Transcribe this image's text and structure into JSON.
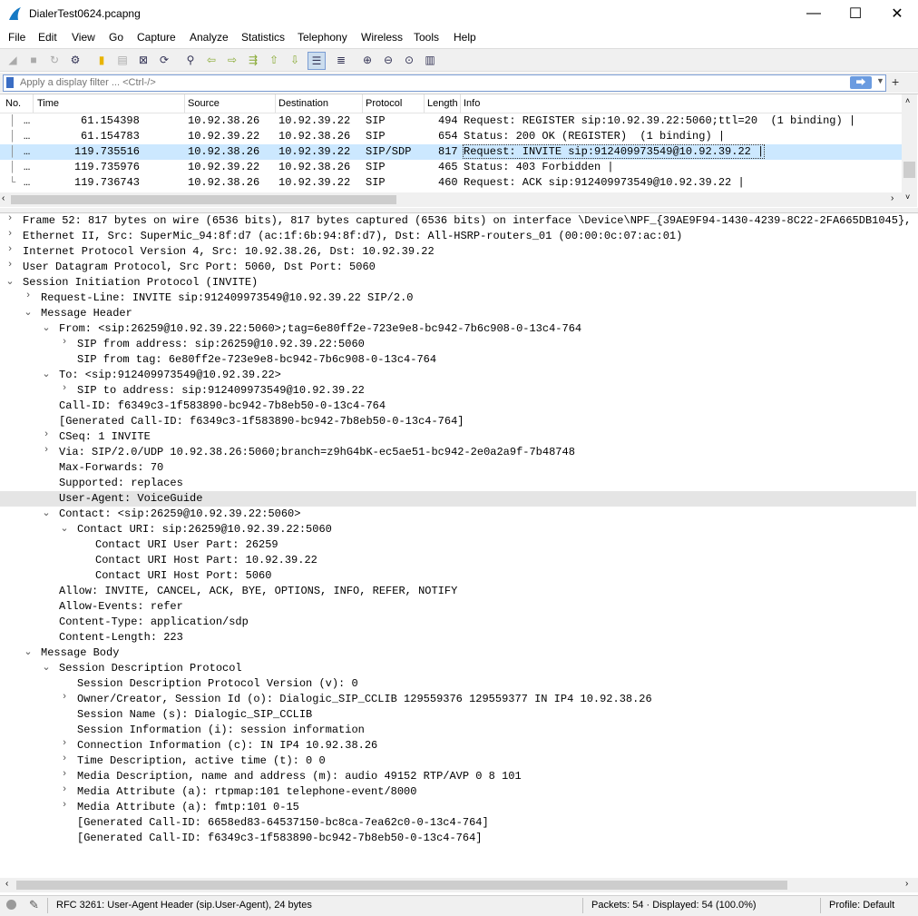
{
  "window": {
    "title": "DialerTest0624.pcapng",
    "minimize": "—",
    "maximize": "☐",
    "close": "✕"
  },
  "menu": [
    "File",
    "Edit",
    "View",
    "Go",
    "Capture",
    "Analyze",
    "Statistics",
    "Telephony",
    "Wireless",
    "Tools",
    "Help"
  ],
  "filter": {
    "placeholder": "Apply a display filter ... <Ctrl-/>",
    "apply": "⮕",
    "dropdown": "▼",
    "add": "+"
  },
  "packet_list": {
    "columns": [
      "No.",
      "Time",
      "Source",
      "Destination",
      "Protocol",
      "Length",
      "Info"
    ],
    "rows": [
      {
        "no": "…",
        "time": "61.154398",
        "src": "10.92.38.26",
        "dst": "10.92.39.22",
        "proto": "SIP",
        "len": "494",
        "info": "Request: REGISTER sip:10.92.39.22:5060;ttl=20  (1 binding) |"
      },
      {
        "no": "…",
        "time": "61.154783",
        "src": "10.92.39.22",
        "dst": "10.92.38.26",
        "proto": "SIP",
        "len": "654",
        "info": "Status: 200 OK (REGISTER)  (1 binding) |"
      },
      {
        "no": "…",
        "time": "119.735516",
        "src": "10.92.38.26",
        "dst": "10.92.39.22",
        "proto": "SIP/SDP",
        "len": "817",
        "info": "Request: INVITE sip:912409973549@10.92.39.22 |"
      },
      {
        "no": "…",
        "time": "119.735976",
        "src": "10.92.39.22",
        "dst": "10.92.38.26",
        "proto": "SIP",
        "len": "465",
        "info": "Status: 403 Forbidden |"
      },
      {
        "no": "…",
        "time": "119.736743",
        "src": "10.92.38.26",
        "dst": "10.92.39.22",
        "proto": "SIP",
        "len": "460",
        "info": "Request: ACK sip:912409973549@10.92.39.22 |"
      }
    ]
  },
  "details": [
    {
      "t": "Frame 52: 817 bytes on wire (6536 bits), 817 bytes captured (6536 bits) on interface \\Device\\NPF_{39AE9F94-1430-4239-8C22-2FA665DB1045}, id 0",
      "a": ">",
      "l": 0
    },
    {
      "t": "Ethernet II, Src: SuperMic_94:8f:d7 (ac:1f:6b:94:8f:d7), Dst: All-HSRP-routers_01 (00:00:0c:07:ac:01)",
      "a": ">",
      "l": 0
    },
    {
      "t": "Internet Protocol Version 4, Src: 10.92.38.26, Dst: 10.92.39.22",
      "a": ">",
      "l": 0
    },
    {
      "t": "User Datagram Protocol, Src Port: 5060, Dst Port: 5060",
      "a": ">",
      "l": 0
    },
    {
      "t": "Session Initiation Protocol (INVITE)",
      "a": "v",
      "l": 0
    },
    {
      "t": "Request-Line: INVITE sip:912409973549@10.92.39.22 SIP/2.0",
      "a": ">",
      "l": 1
    },
    {
      "t": "Message Header",
      "a": "v",
      "l": 1
    },
    {
      "t": "From: <sip:26259@10.92.39.22:5060>;tag=6e80ff2e-723e9e8-bc942-7b6c908-0-13c4-764",
      "a": "v",
      "l": 2
    },
    {
      "t": "SIP from address: sip:26259@10.92.39.22:5060",
      "a": ">",
      "l": 3
    },
    {
      "t": "SIP from tag: 6e80ff2e-723e9e8-bc942-7b6c908-0-13c4-764",
      "a": "",
      "l": 3
    },
    {
      "t": "To: <sip:912409973549@10.92.39.22>",
      "a": "v",
      "l": 2
    },
    {
      "t": "SIP to address: sip:912409973549@10.92.39.22",
      "a": ">",
      "l": 3
    },
    {
      "t": "Call-ID: f6349c3-1f583890-bc942-7b8eb50-0-13c4-764",
      "a": "",
      "l": 2
    },
    {
      "t": "[Generated Call-ID: f6349c3-1f583890-bc942-7b8eb50-0-13c4-764]",
      "a": "",
      "l": 2
    },
    {
      "t": "CSeq: 1 INVITE",
      "a": ">",
      "l": 2
    },
    {
      "t": "Via: SIP/2.0/UDP 10.92.38.26:5060;branch=z9hG4bK-ec5ae51-bc942-2e0a2a9f-7b48748",
      "a": ">",
      "l": 2
    },
    {
      "t": "Max-Forwards: 70",
      "a": "",
      "l": 2
    },
    {
      "t": "Supported: replaces",
      "a": "",
      "l": 2
    },
    {
      "t": "User-Agent: VoiceGuide",
      "a": "",
      "l": 2,
      "hl": true
    },
    {
      "t": "Contact: <sip:26259@10.92.39.22:5060>",
      "a": "v",
      "l": 2
    },
    {
      "t": "Contact URI: sip:26259@10.92.39.22:5060",
      "a": "v",
      "l": 3
    },
    {
      "t": "Contact URI User Part: 26259",
      "a": "",
      "l": 4
    },
    {
      "t": "Contact URI Host Part: 10.92.39.22",
      "a": "",
      "l": 4
    },
    {
      "t": "Contact URI Host Port: 5060",
      "a": "",
      "l": 4
    },
    {
      "t": "Allow: INVITE, CANCEL, ACK, BYE, OPTIONS, INFO, REFER, NOTIFY",
      "a": "",
      "l": 2
    },
    {
      "t": "Allow-Events: refer",
      "a": "",
      "l": 2
    },
    {
      "t": "Content-Type: application/sdp",
      "a": "",
      "l": 2
    },
    {
      "t": "Content-Length: 223",
      "a": "",
      "l": 2
    },
    {
      "t": "Message Body",
      "a": "v",
      "l": 1
    },
    {
      "t": "Session Description Protocol",
      "a": "v",
      "l": 2
    },
    {
      "t": "Session Description Protocol Version (v): 0",
      "a": "",
      "l": 3
    },
    {
      "t": "Owner/Creator, Session Id (o): Dialogic_SIP_CCLIB 129559376 129559377 IN IP4 10.92.38.26",
      "a": ">",
      "l": 3
    },
    {
      "t": "Session Name (s): Dialogic_SIP_CCLIB",
      "a": "",
      "l": 3
    },
    {
      "t": "Session Information (i): session information",
      "a": "",
      "l": 3
    },
    {
      "t": "Connection Information (c): IN IP4 10.92.38.26",
      "a": ">",
      "l": 3
    },
    {
      "t": "Time Description, active time (t): 0 0",
      "a": ">",
      "l": 3
    },
    {
      "t": "Media Description, name and address (m): audio 49152 RTP/AVP 0 8 101",
      "a": ">",
      "l": 3
    },
    {
      "t": "Media Attribute (a): rtpmap:101 telephone-event/8000",
      "a": ">",
      "l": 3
    },
    {
      "t": "Media Attribute (a): fmtp:101 0-15",
      "a": ">",
      "l": 3
    },
    {
      "t": "[Generated Call-ID: 6658ed83-64537150-bc8ca-7ea62c0-0-13c4-764]",
      "a": "",
      "l": 3
    },
    {
      "t": "[Generated Call-ID: f6349c3-1f583890-bc942-7b8eb50-0-13c4-764]",
      "a": "",
      "l": 3
    }
  ],
  "status": {
    "field": "RFC 3261: User-Agent Header (sip.User-Agent), 24 bytes",
    "packets": "Packets: 54 · Displayed: 54 (100.0%)",
    "profile": "Profile: Default"
  },
  "colors": {
    "selected_row": "#cce8ff",
    "highlight_row": "#e5e5e5",
    "accent": "#3a6dc4"
  }
}
